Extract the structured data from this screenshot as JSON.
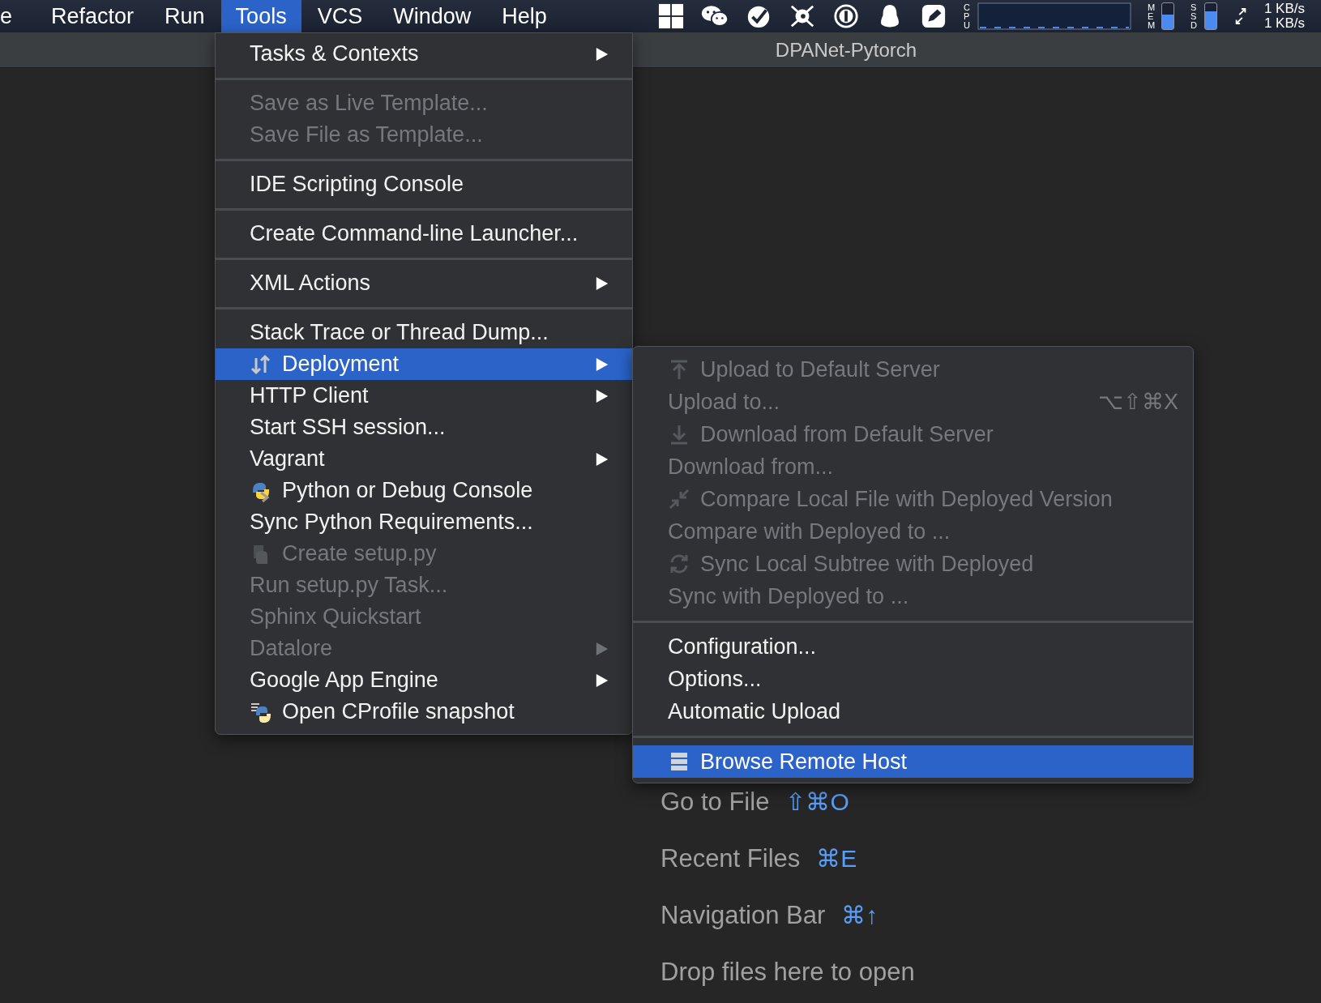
{
  "menubar": {
    "items": [
      {
        "label": "e",
        "selected": false
      },
      {
        "label": "Refactor",
        "selected": false
      },
      {
        "label": "Run",
        "selected": false
      },
      {
        "label": "Tools",
        "selected": true
      },
      {
        "label": "VCS",
        "selected": false
      },
      {
        "label": "Window",
        "selected": false
      },
      {
        "label": "Help",
        "selected": false
      }
    ],
    "tray": {
      "cpu_label": "CPU",
      "meters": [
        {
          "label": "MEM",
          "level": 0.55
        },
        {
          "label": "SSD",
          "level": 0.7
        }
      ],
      "net": [
        "1 KB/s",
        "1 KB/s"
      ]
    }
  },
  "window": {
    "title": "DPANet-Pytorch"
  },
  "tools_menu": {
    "sections": [
      {
        "items": [
          {
            "label": "Tasks & Contexts",
            "kind": "plain",
            "disabled": false,
            "selected": false,
            "submenu": true
          }
        ]
      },
      {
        "items": [
          {
            "label": "Save as Live Template...",
            "kind": "plain",
            "disabled": true,
            "selected": false,
            "submenu": false
          },
          {
            "label": "Save File as Template...",
            "kind": "plain",
            "disabled": true,
            "selected": false,
            "submenu": false
          }
        ]
      },
      {
        "items": [
          {
            "label": "IDE Scripting Console",
            "kind": "plain",
            "disabled": false,
            "selected": false,
            "submenu": false
          }
        ]
      },
      {
        "items": [
          {
            "label": "Create Command-line Launcher...",
            "kind": "plain",
            "disabled": false,
            "selected": false,
            "submenu": false
          }
        ]
      },
      {
        "items": [
          {
            "label": "XML Actions",
            "kind": "plain",
            "disabled": false,
            "selected": false,
            "submenu": true
          }
        ]
      },
      {
        "items": [
          {
            "label": "Stack Trace or Thread Dump...",
            "kind": "plain",
            "disabled": false,
            "selected": false,
            "submenu": false
          },
          {
            "label": "Deployment",
            "kind": "deploy",
            "disabled": false,
            "selected": true,
            "submenu": true
          },
          {
            "label": "HTTP Client",
            "kind": "plain",
            "disabled": false,
            "selected": false,
            "submenu": true
          },
          {
            "label": "Start SSH session...",
            "kind": "plain",
            "disabled": false,
            "selected": false,
            "submenu": false
          },
          {
            "label": "Vagrant",
            "kind": "plain",
            "disabled": false,
            "selected": false,
            "submenu": true
          },
          {
            "label": "Python or Debug Console",
            "kind": "python",
            "disabled": false,
            "selected": false,
            "submenu": false
          },
          {
            "label": "Sync Python Requirements...",
            "kind": "plain",
            "disabled": false,
            "selected": false,
            "submenu": false
          },
          {
            "label": "Create setup.py",
            "kind": "setup",
            "disabled": true,
            "selected": false,
            "submenu": false
          },
          {
            "label": "Run setup.py Task...",
            "kind": "plain",
            "disabled": true,
            "selected": false,
            "submenu": false
          },
          {
            "label": "Sphinx Quickstart",
            "kind": "plain",
            "disabled": true,
            "selected": false,
            "submenu": false
          },
          {
            "label": "Datalore",
            "kind": "plain",
            "disabled": true,
            "selected": false,
            "submenu": true
          },
          {
            "label": "Google App Engine",
            "kind": "plain",
            "disabled": false,
            "selected": false,
            "submenu": true
          },
          {
            "label": "Open CProfile snapshot",
            "kind": "cprofile",
            "disabled": false,
            "selected": false,
            "submenu": false
          }
        ]
      }
    ]
  },
  "deployment_menu": {
    "sections": [
      {
        "items": [
          {
            "label": "Upload to Default Server",
            "kind": "upload",
            "disabled": true,
            "selected": false
          },
          {
            "label": "Upload to...",
            "kind": "plain",
            "disabled": true,
            "selected": false,
            "shortcut": "⌥⇧⌘X"
          },
          {
            "label": "Download from Default Server",
            "kind": "download",
            "disabled": true,
            "selected": false
          },
          {
            "label": "Download from...",
            "kind": "plain",
            "disabled": true,
            "selected": false
          },
          {
            "label": "Compare Local File with Deployed Version",
            "kind": "compare",
            "disabled": true,
            "selected": false
          },
          {
            "label": "Compare with Deployed to ...",
            "kind": "plain",
            "disabled": true,
            "selected": false
          },
          {
            "label": "Sync Local Subtree with Deployed",
            "kind": "sync",
            "disabled": true,
            "selected": false
          },
          {
            "label": "Sync with Deployed to ...",
            "kind": "plain",
            "disabled": true,
            "selected": false
          }
        ]
      },
      {
        "items": [
          {
            "label": "Configuration...",
            "kind": "plain",
            "disabled": false,
            "selected": false
          },
          {
            "label": "Options...",
            "kind": "plain",
            "disabled": false,
            "selected": false
          },
          {
            "label": "Automatic Upload",
            "kind": "plain",
            "disabled": false,
            "selected": false
          }
        ]
      },
      {
        "items": [
          {
            "label": "Browse Remote Host",
            "kind": "server",
            "disabled": false,
            "selected": true
          }
        ]
      }
    ]
  },
  "welcome": {
    "hints": [
      {
        "label": "Go to File",
        "shortcut": "⇧⌘O"
      },
      {
        "label": "Recent Files",
        "shortcut": "⌘E"
      },
      {
        "label": "Navigation Bar",
        "shortcut": "⌘↑"
      }
    ],
    "drop_text": "Drop files here to open"
  }
}
